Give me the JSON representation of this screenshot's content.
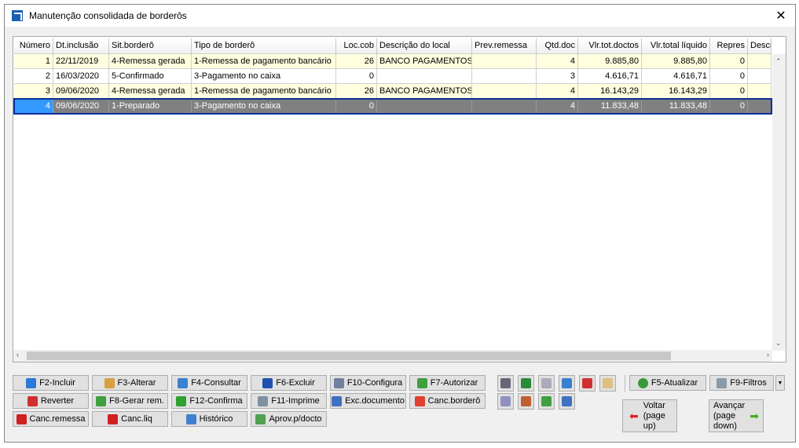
{
  "window": {
    "title": "Manutenção consolidada de borderôs",
    "close": "✕"
  },
  "grid": {
    "columns": [
      "Número",
      "Dt.inclusão",
      "Sit.borderô",
      "Tipo de borderô",
      "Loc.cob",
      "Descrição do local",
      "Prev.remessa",
      "Qtd.doc",
      "Vlr.tot.doctos",
      "Vlr.total líquido",
      "Repres",
      "Descr"
    ],
    "rows": [
      [
        "1",
        "22/11/2019",
        "4-Remessa gerada",
        "1-Remessa de pagamento bancário",
        "26",
        "BANCO PAGAMENTOS",
        "",
        "4",
        "9.885,80",
        "9.885,80",
        "0",
        ""
      ],
      [
        "2",
        "16/03/2020",
        "5-Confirmado",
        "3-Pagamento no caixa",
        "0",
        "",
        "",
        "3",
        "4.616,71",
        "4.616,71",
        "0",
        ""
      ],
      [
        "3",
        "09/06/2020",
        "4-Remessa gerada",
        "1-Remessa de pagamento bancário",
        "26",
        "BANCO PAGAMENTOS",
        "",
        "4",
        "16.143,29",
        "16.143,29",
        "0",
        ""
      ],
      [
        "4",
        "09/06/2020",
        "1-Preparado",
        "3-Pagamento no caixa",
        "0",
        "",
        "",
        "4",
        "11.833,48",
        "11.833,48",
        "0",
        ""
      ]
    ],
    "selected_row": 4
  },
  "buttons": [
    [
      "F2-Incluir",
      "F3-Alterar",
      "F4-Consultar",
      "F6-Excluir",
      "F10-Configura",
      "F7-Autorizar"
    ],
    [
      "Reverter",
      "F8-Gerar rem.",
      "F12-Confirma",
      "F11-Imprime",
      "Exc.documento",
      "Canc.borderô"
    ],
    [
      "Canc.remessa",
      "Canc.liq",
      "Histórico",
      "Aprov.p/docto"
    ]
  ],
  "icon_buttons": [
    "binoculars-icon",
    "excel-icon",
    "document-icon",
    "calendar-icon",
    "sort-icon",
    "palette-icon",
    "gear-icon",
    "user-check-icon",
    "download-icon",
    "checklist-icon"
  ],
  "refresh": "F5-Atualizar",
  "filters": "F9-Filtros",
  "back": {
    "line1": "Voltar",
    "line2": "(page up)"
  },
  "next": {
    "line1": "Avançar",
    "line2": "(page down)"
  }
}
